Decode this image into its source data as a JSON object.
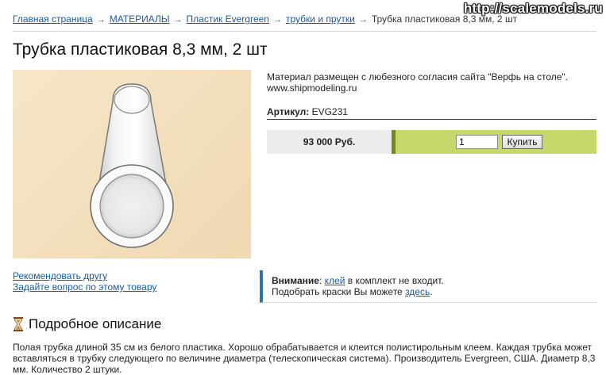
{
  "watermark": "http://scalemodels.ru",
  "breadcrumb": {
    "items": [
      "Главная страница",
      "МАТЕРИАЛЫ",
      "Пластик Evergreen",
      "трубки и прутки"
    ],
    "separator": "→",
    "current": "Трубка пластиковая 8,3 мм, 2 шт"
  },
  "product": {
    "title": "Трубка пластиковая 8,3 мм, 2 шт",
    "material_note": "Материал размещен с любезного согласия сайта \"Верфь на столе\". www.shipmodeling.ru",
    "sku_label": "Артикул:",
    "sku_value": "EVG231",
    "price": "93 000 Руб.",
    "quantity": "1",
    "buy_label": "Купить"
  },
  "links": {
    "recommend": "Рекомендовать другу",
    "ask": "Задайте вопрос по этому товару"
  },
  "notice": {
    "label": "Внимание",
    "colon": ":",
    "glue_link": "клей",
    "line1_rest": " в комплект не входит.",
    "line2_text": "Подобрать краски Вы можете ",
    "here_link": "здесь",
    "period": "."
  },
  "description": {
    "heading": "Подробное описание",
    "icon": "hourglass-icon",
    "text": "Полая трубка длиной 35 см из белого пластика. Хорошо обрабатывается и клеится полистирольным клеем. Каждая трубка может вставляться в трубку следующего по величине диаметра (телескопическая система). Производитель Evergreen, США. Диаметр 8,3 мм. Количество 2 штуки."
  },
  "colors": {
    "link": "#1a5a9c",
    "buy_bar": "#c6d86a",
    "buy_bar_accent": "#6f8a1e",
    "notice_accent": "#2f73a8",
    "image_bg": "#f3dfbd"
  }
}
